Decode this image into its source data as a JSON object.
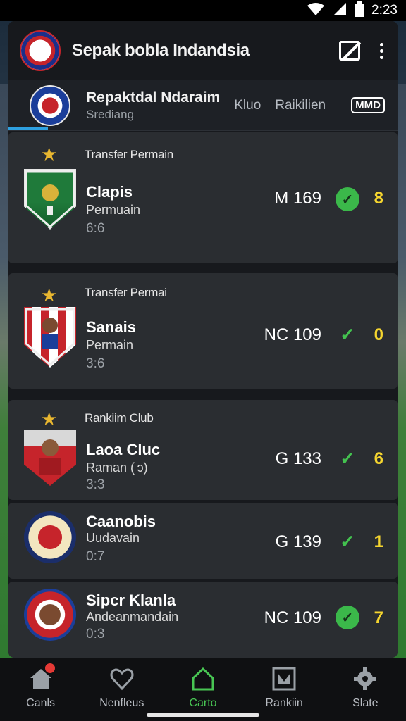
{
  "status": {
    "time": "2:23"
  },
  "header": {
    "title": "Sepak bobla Indandsia",
    "logo_icon": "club-logo-icon",
    "edit_icon": "edit-icon",
    "more_icon": "more-vertical-icon"
  },
  "tab_row": {
    "title": "Repaktdal Ndaraim",
    "subtitle": "Srediang",
    "link_club": "Kluo",
    "link_ranking": "Raikilien",
    "badge": "MMD"
  },
  "cards": [
    {
      "label": "Transfer Permain",
      "name": "Clapis",
      "sub": "Permuain",
      "score": "6:6",
      "stat": "M  169",
      "status_icon": "check-circle-icon",
      "count": "8"
    },
    {
      "label": "Transfer Permai",
      "name": "Sanais",
      "sub": "Permain",
      "score": "3:6",
      "stat": "NC 109",
      "status_icon": "check-icon",
      "count": "0"
    },
    {
      "label": "Rankiim Club",
      "name": "Laoa Cluc",
      "sub": "Raman ( ɔ)",
      "score": "3:3",
      "stat": "G 133",
      "status_icon": "check-icon",
      "count": "6"
    },
    {
      "label": "",
      "name": "Caanobis",
      "sub": "Uudavain",
      "score": "0:7",
      "stat": "G 139",
      "status_icon": "check-icon",
      "count": "1"
    },
    {
      "label": "",
      "name": "Sipcr Klanla",
      "sub": "Andeanmandain",
      "score": "0:3",
      "stat": "NC 109",
      "status_icon": "check-circle-icon",
      "count": "7"
    }
  ],
  "nav": [
    {
      "label": "Canls",
      "icon": "home-icon"
    },
    {
      "label": "Nenfleus",
      "icon": "heart-icon"
    },
    {
      "label": "Carto",
      "icon": "house-outline-icon"
    },
    {
      "label": "Rankiin",
      "icon": "ranking-icon"
    },
    {
      "label": "Slate",
      "icon": "settings-gear-icon"
    }
  ],
  "colors": {
    "accent_green": "#3bb84a",
    "count_yellow": "#f5d52f",
    "star_gold": "#e9b730",
    "tab_underline": "#2ea0e0"
  }
}
